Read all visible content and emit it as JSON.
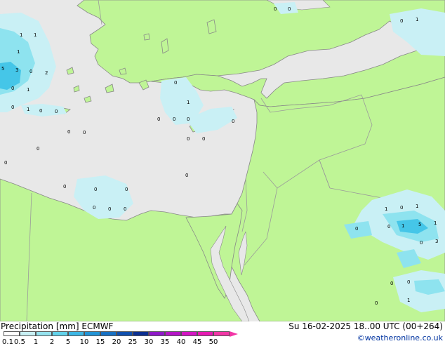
{
  "map": {
    "colors": {
      "sea": "#e8e8e8",
      "land": "#bff596",
      "border": "#9a9a9a",
      "coast": "#888888",
      "precip_light": "#c9f0f5",
      "precip_mid": "#8ee3ef",
      "precip_heavy": "#45c6e8"
    },
    "value_labels": [
      {
        "text": "1",
        "tone": "dark"
      },
      {
        "text": "1",
        "tone": "dark"
      },
      {
        "text": "1",
        "tone": "dark"
      },
      {
        "text": "5",
        "tone": "dark"
      },
      {
        "text": "3",
        "tone": "dark"
      },
      {
        "text": "0",
        "tone": "dark"
      },
      {
        "text": "2",
        "tone": "dark"
      },
      {
        "text": "0",
        "tone": "dark"
      },
      {
        "text": "1",
        "tone": "dark"
      },
      {
        "text": "0",
        "tone": "dark"
      },
      {
        "text": "1",
        "tone": "dark"
      },
      {
        "text": "0",
        "tone": "dark"
      },
      {
        "text": "0",
        "tone": "dark"
      },
      {
        "text": "0",
        "tone": "dark"
      },
      {
        "text": "0",
        "tone": "dark"
      },
      {
        "text": "0",
        "tone": "dark"
      },
      {
        "text": "1",
        "tone": "dark"
      },
      {
        "text": "0",
        "tone": "dark"
      },
      {
        "text": "0",
        "tone": "dark"
      },
      {
        "text": "0",
        "tone": "dark"
      },
      {
        "text": "0",
        "tone": "dark"
      },
      {
        "text": "0",
        "tone": "dark"
      },
      {
        "text": "0",
        "tone": "dark"
      },
      {
        "text": "0",
        "tone": "dark"
      },
      {
        "text": "0",
        "tone": "dark"
      },
      {
        "text": "0",
        "tone": "dark"
      },
      {
        "text": "0",
        "tone": "dark"
      },
      {
        "text": "0",
        "tone": "dark"
      },
      {
        "text": "0",
        "tone": "dark"
      },
      {
        "text": "0",
        "tone": "dark"
      },
      {
        "text": "0",
        "tone": "dark"
      },
      {
        "text": "0",
        "tone": "dark"
      },
      {
        "text": "0",
        "tone": "dark"
      },
      {
        "text": "0",
        "tone": "dark"
      },
      {
        "text": "0",
        "tone": "dark"
      },
      {
        "text": "1",
        "tone": "dark"
      },
      {
        "text": "1",
        "tone": "dark"
      },
      {
        "text": "0",
        "tone": "dark"
      },
      {
        "text": "1",
        "tone": "dark"
      },
      {
        "text": "0",
        "tone": "dark"
      },
      {
        "text": "5",
        "tone": "dark"
      },
      {
        "text": "1",
        "tone": "dark"
      },
      {
        "text": "1",
        "tone": "dark"
      },
      {
        "text": "0",
        "tone": "dark"
      },
      {
        "text": "3",
        "tone": "dark"
      },
      {
        "text": "0",
        "tone": "dark"
      },
      {
        "text": "0",
        "tone": "dark"
      },
      {
        "text": "0",
        "tone": "dark"
      },
      {
        "text": "1",
        "tone": "dark"
      },
      {
        "text": "0",
        "tone": "dark"
      }
    ]
  },
  "footer": {
    "title": "Precipitation [mm]  ECMWF",
    "datetime": "Su 16-02-2025 18..00 UTC (00+264)",
    "credit": "©weatheronline.co.uk",
    "scale_labels": [
      "0.1",
      "0.5",
      "1",
      "2",
      "5",
      "10",
      "15",
      "20",
      "25",
      "30",
      "35",
      "40",
      "45",
      "50"
    ],
    "scale_colors": [
      "#ffffff",
      "#c8f0f4",
      "#95e2ee",
      "#62d2ea",
      "#3cb6e4",
      "#2294d6",
      "#1771c4",
      "#0f4fae",
      "#0a2f91",
      "#8e18c8",
      "#b414c6",
      "#d414c4",
      "#e61ab2",
      "#f236a6"
    ]
  }
}
